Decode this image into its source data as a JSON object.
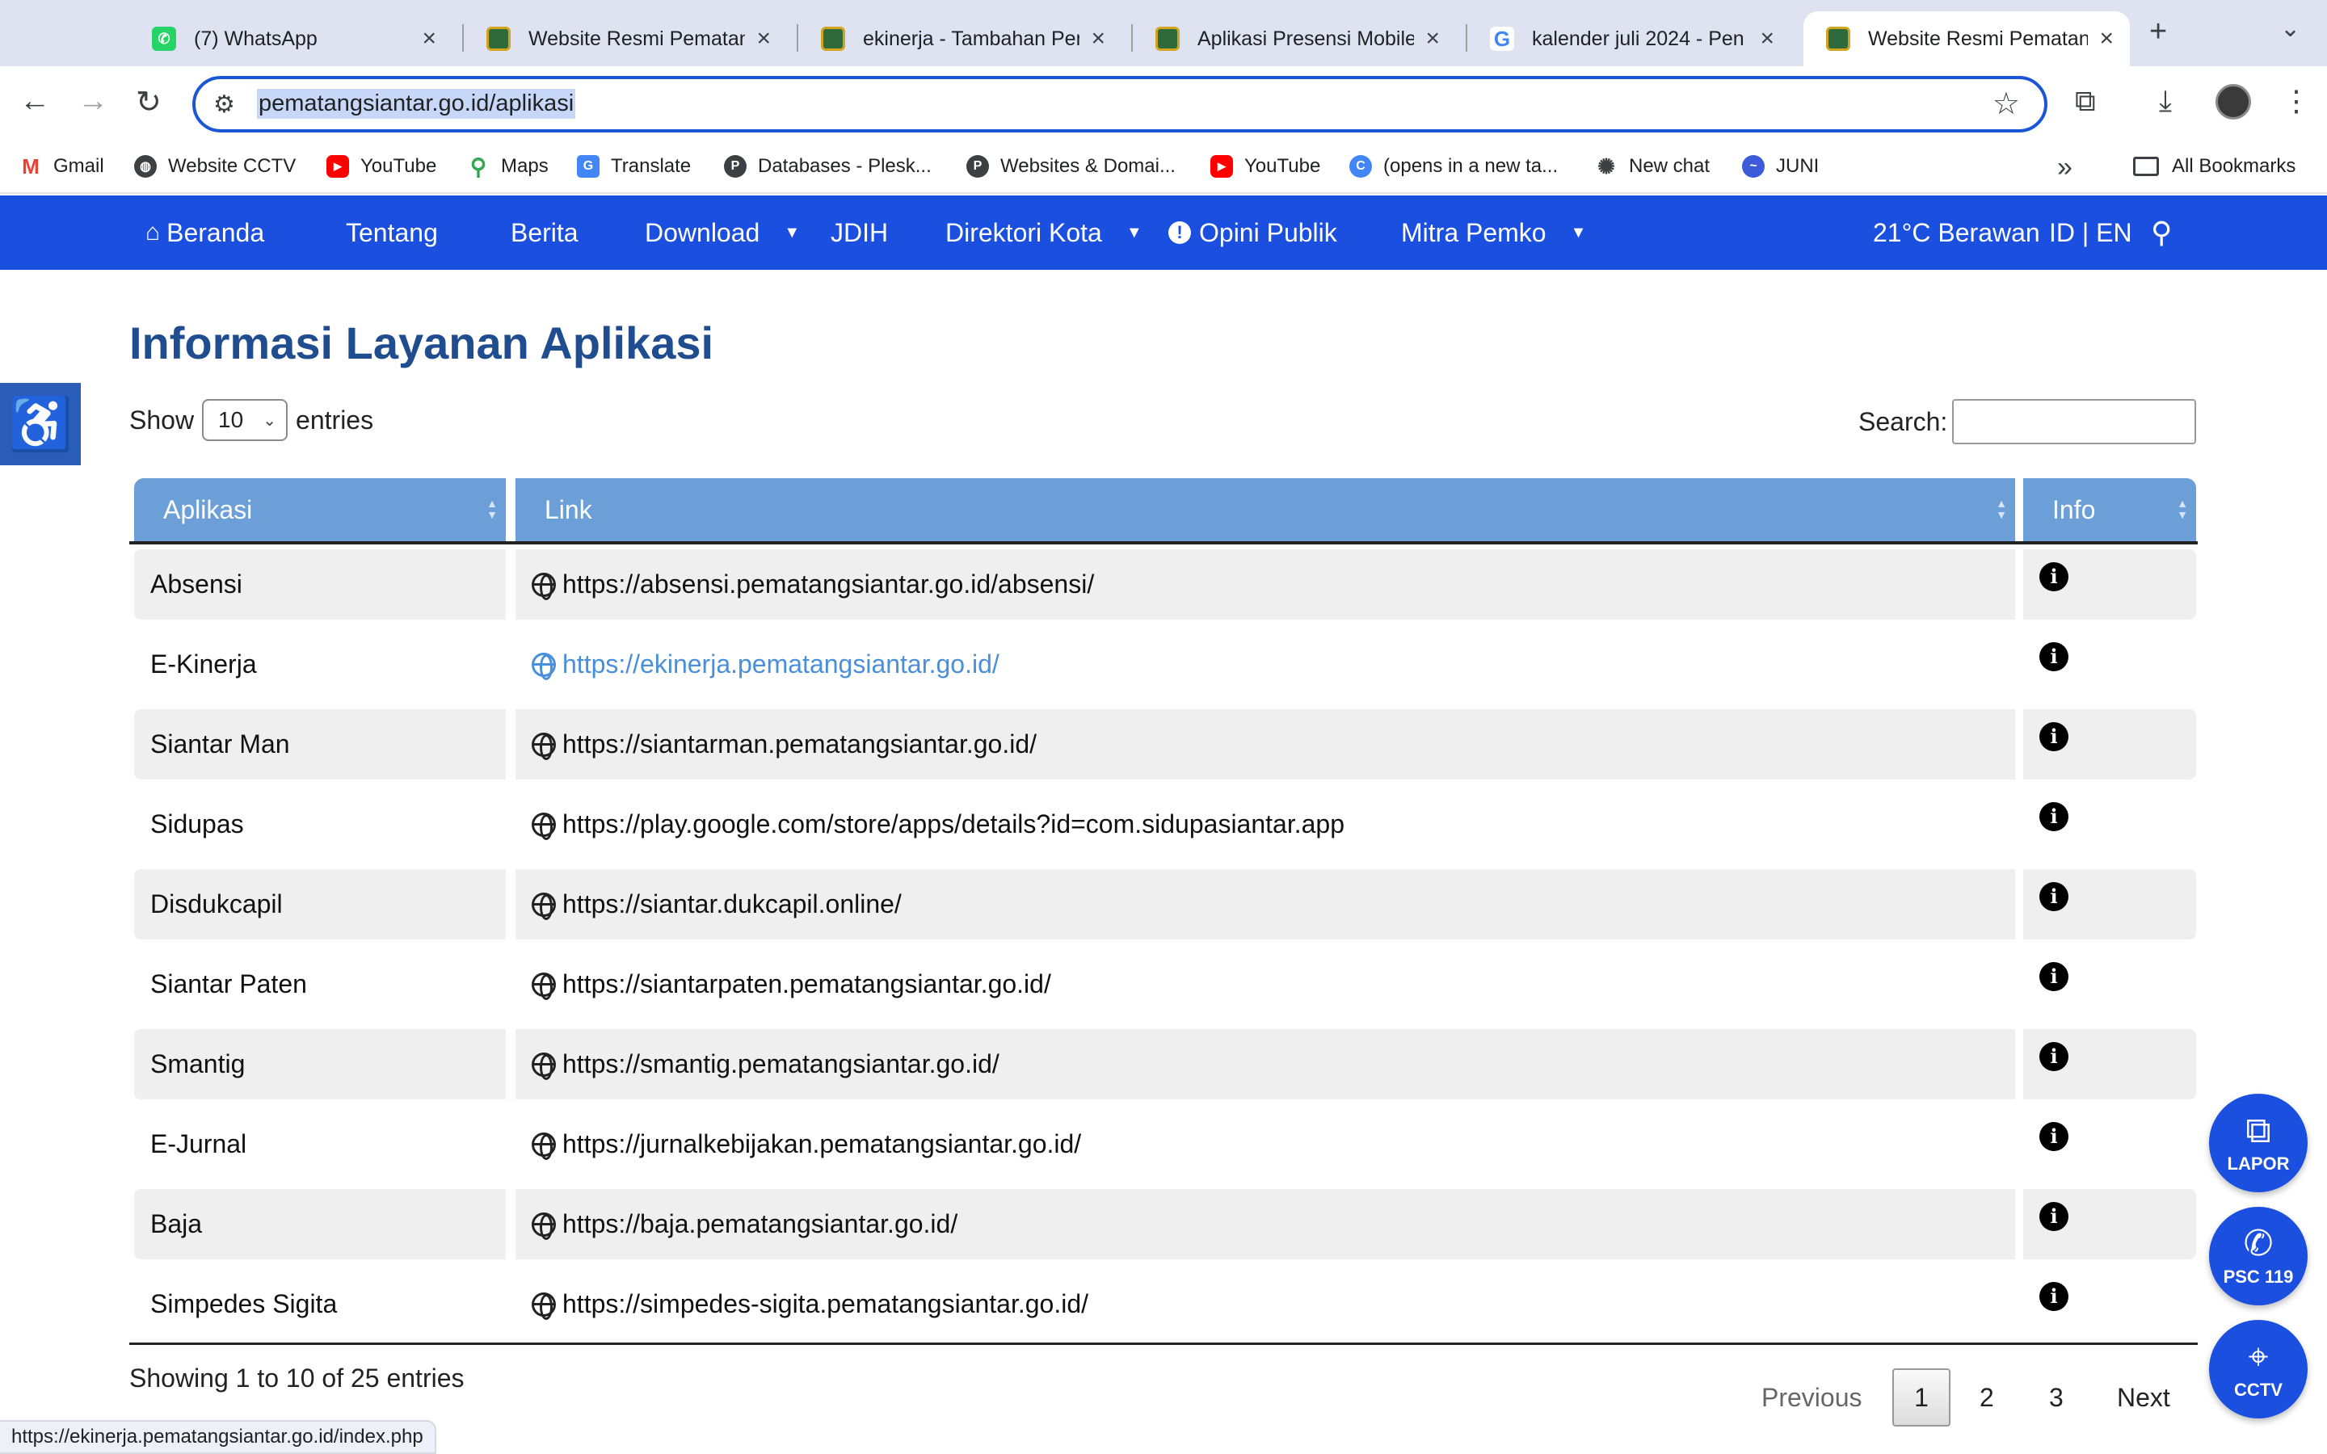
{
  "browser": {
    "tabs": [
      {
        "title": "(7) WhatsApp",
        "favicon": "whatsapp-icon",
        "active": false
      },
      {
        "title": "Website Resmi Pematang",
        "favicon": "gov-logo-icon",
        "active": false
      },
      {
        "title": "ekinerja - Tambahan Pen",
        "favicon": "gov-logo-icon",
        "active": false
      },
      {
        "title": "Aplikasi Presensi Mobile",
        "favicon": "gov-logo-icon",
        "active": false
      },
      {
        "title": "kalender juli 2024 - Pen",
        "favicon": "google-icon",
        "active": false
      },
      {
        "title": "Website Resmi Pematang",
        "favicon": "gov-logo-icon",
        "active": true
      }
    ],
    "url": "pematangsiantar.go.id/aplikasi",
    "bookmarks": [
      {
        "label": "Gmail",
        "icon": "gmail-icon"
      },
      {
        "label": "Website CCTV",
        "icon": "globe-icon"
      },
      {
        "label": "YouTube",
        "icon": "youtube-icon"
      },
      {
        "label": "Maps",
        "icon": "maps-icon"
      },
      {
        "label": "Translate",
        "icon": "translate-icon"
      },
      {
        "label": "Databases - Plesk...",
        "icon": "plesk-icon"
      },
      {
        "label": "Websites & Domai...",
        "icon": "plesk-icon"
      },
      {
        "label": "YouTube",
        "icon": "youtube-icon"
      },
      {
        "label": "(opens in a new ta...",
        "icon": "canva-icon"
      },
      {
        "label": "New chat",
        "icon": "chatgpt-icon"
      },
      {
        "label": "JUNI",
        "icon": "juni-icon"
      }
    ],
    "all_bookmarks": "All Bookmarks",
    "status_url": "https://ekinerja.pematangsiantar.go.id/index.php"
  },
  "site_nav": {
    "items": [
      {
        "label": "Beranda",
        "icon": "home-icon",
        "dropdown": false
      },
      {
        "label": "Tentang",
        "dropdown": false
      },
      {
        "label": "Berita",
        "dropdown": false
      },
      {
        "label": "Download",
        "dropdown": true
      },
      {
        "label": "JDIH",
        "dropdown": false
      },
      {
        "label": "Direktori Kota",
        "dropdown": true
      },
      {
        "label": "Opini Publik",
        "icon": "exclamation-circle-icon",
        "dropdown": false
      },
      {
        "label": "Mitra Pemko",
        "dropdown": true
      }
    ],
    "weather": "21°C Berawan",
    "lang": "ID | EN"
  },
  "page": {
    "title": "Informasi Layanan Aplikasi",
    "show_label": "Show",
    "entries_value": "10",
    "entries_label": "entries",
    "search_label": "Search:",
    "search_value": ""
  },
  "table": {
    "columns": [
      "Aplikasi",
      "Link",
      "Info"
    ],
    "rows": [
      {
        "app": "Absensi",
        "link": "https://absensi.pematangsiantar.go.id/absensi/"
      },
      {
        "app": "E-Kinerja",
        "link": "https://ekinerja.pematangsiantar.go.id/"
      },
      {
        "app": "Siantar Man",
        "link": "https://siantarman.pematangsiantar.go.id/"
      },
      {
        "app": "Sidupas",
        "link": "https://play.google.com/store/apps/details?id=com.sidupasiantar.app"
      },
      {
        "app": "Disdukcapil",
        "link": "https://siantar.dukcapil.online/"
      },
      {
        "app": "Siantar Paten",
        "link": "https://siantarpaten.pematangsiantar.go.id/"
      },
      {
        "app": "Smantig",
        "link": "https://smantig.pematangsiantar.go.id/"
      },
      {
        "app": "E-Jurnal",
        "link": "https://jurnalkebijakan.pematangsiantar.go.id/"
      },
      {
        "app": "Baja",
        "link": "https://baja.pematangsiantar.go.id/"
      },
      {
        "app": "Simpedes Sigita",
        "link": "https://simpedes-sigita.pematangsiantar.go.id/"
      }
    ]
  },
  "footer": {
    "showing": "Showing 1 to 10 of 25 entries",
    "prev": "Previous",
    "pages": [
      "1",
      "2",
      "3"
    ],
    "next": "Next"
  },
  "fabs": [
    {
      "label": "LAPOR",
      "icon": "chat-bubbles-icon"
    },
    {
      "label": "PSC 119",
      "icon": "phone-icon"
    },
    {
      "label": "CCTV",
      "icon": "camera-icon"
    }
  ],
  "colors": {
    "nav_bg": "#1b4fe0",
    "header_bg": "#6c9fd8",
    "title": "#1f4d8f",
    "link_hover": "#4a8fd9"
  }
}
